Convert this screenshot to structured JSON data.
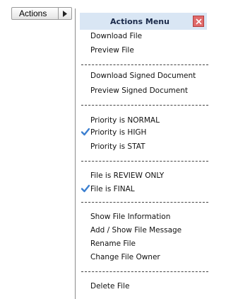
{
  "button": {
    "label": "Actions"
  },
  "menu": {
    "title": "Actions Menu",
    "groups": [
      [
        "Download File",
        "Preview File"
      ],
      [
        "Download Signed Document",
        "Preview Signed Document"
      ],
      [
        "Priority is NORMAL",
        "Priority is HIGH",
        "Priority is STAT"
      ],
      [
        "File is REVIEW ONLY",
        "File is FINAL"
      ],
      [
        "Show File Information",
        "Add / Show File Message",
        "Rename File",
        "Change File Owner"
      ],
      [
        "Delete File"
      ]
    ],
    "checked": [
      "Priority is HIGH",
      "File is FINAL"
    ]
  },
  "colors": {
    "header_bg": "#d9e6f4",
    "close_bg": "#e06a6a",
    "check": "#3b7fd0"
  }
}
